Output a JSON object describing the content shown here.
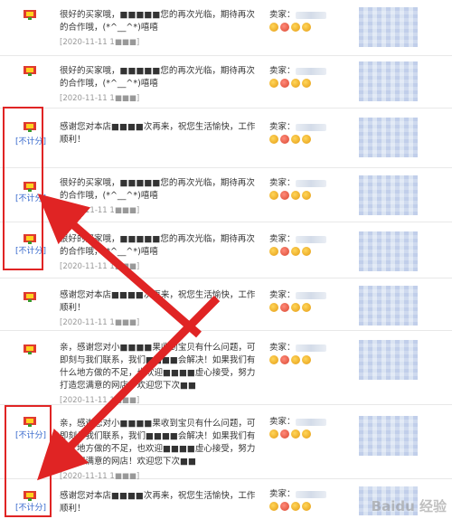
{
  "rows": [
    {
      "text": "很好的买家哦，■■■■■您的再次光临，期待再次的合作哦，(*^__^*)嘻嘻",
      "date": "[2020-11-11 1■■■]",
      "no_count": "",
      "seller": "卖家："
    },
    {
      "text": "很好的买家哦，■■■■■您的再次光临，期待再次的合作哦，(*^__^*)嘻嘻",
      "date": "[2020-11-11 1■■■]",
      "no_count": "",
      "seller": "卖家："
    },
    {
      "text": "感谢您对本店■■■■次再来，祝您生活愉快，工作顺利！",
      "date": "",
      "no_count": "[不计分]",
      "seller": "卖家："
    },
    {
      "text": "很好的买家哦，■■■■■您的再次光临，期待再次的合作哦，(*^__^*)嘻嘻",
      "date": "[2020-11-11 1■■■]",
      "no_count": "[不计分]",
      "seller": "卖家："
    },
    {
      "text": "很好的买家哦，■■■■■您的再次光临，期待再次的合作哦，(*^__^*)嘻嘻",
      "date": "[2020-11-11 1■■■]",
      "no_count": "[不计分]",
      "seller": "卖家："
    },
    {
      "text": "感谢您对本店■■■■次再来，祝您生活愉快，工作顺利！",
      "date": "[2020-11-11 1■■■]",
      "no_count": "",
      "seller": "卖家："
    },
    {
      "text": "亲，感谢您对小■■■■果收到宝贝有什么问题，可即刻与我们联系，我们■■■■会解决！如果我们有什么地方做的不足，也欢迎■■■■虚心接受，努力打造您满意的网店！欢迎您下次■■",
      "date": "[2020-11-11 1■■■]",
      "no_count": "",
      "seller": "卖家："
    },
    {
      "text": "亲，感谢您对小■■■■果收到宝贝有什么问题，可即刻与我们联系，我们■■■■会解决！如果我们有什么地方做的不足，也欢迎■■■■虚心接受，努力打造您满意的网店！欢迎您下次■■",
      "date": "[2020-11-11 1■■■]",
      "no_count": "[不计分]",
      "seller": "卖家："
    },
    {
      "text": "感谢您对本店■■■■次再来，祝您生活愉快，工作顺利！",
      "date": "",
      "no_count": "[不计分]",
      "seller": "卖家："
    }
  ],
  "watermark": "Baidu 经验",
  "colors": {
    "highlight": "#e02424",
    "no_count_link": "#3366cc",
    "arrow": "#e02424"
  }
}
